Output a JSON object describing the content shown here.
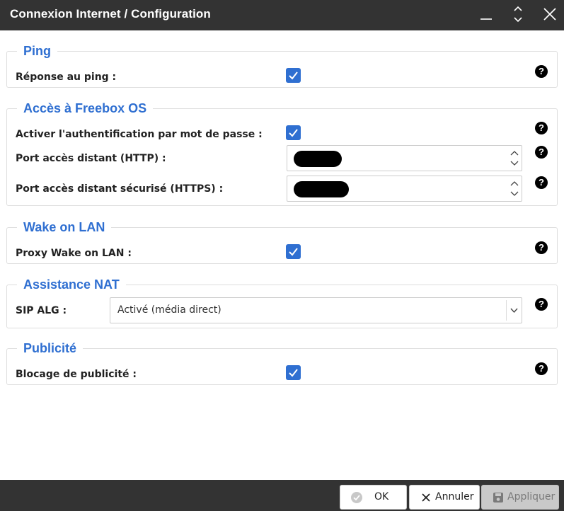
{
  "window": {
    "title": "Connexion Internet / Configuration",
    "controls": {
      "minimize_icon": "minimize-icon",
      "restore_icon": "expand-collapse-icon",
      "close_icon": "close-icon"
    }
  },
  "sections": {
    "ping": {
      "legend": "Ping",
      "reply_label": "Réponse au ping :",
      "reply_checked": true
    },
    "freebox_os": {
      "legend": "Accès à Freebox OS",
      "auth_label": "Activer l'authentification par mot de passe :",
      "auth_checked": true,
      "http_port_label": "Port accès distant (HTTP) :",
      "https_port_label": "Port accès distant sécurisé (HTTPS) :"
    },
    "wake_on_lan": {
      "legend": "Wake on LAN",
      "proxy_label": "Proxy Wake on LAN :",
      "proxy_checked": true
    },
    "nat": {
      "legend": "Assistance NAT",
      "sip_alg_label": "SIP ALG :",
      "sip_alg_value": "Activé (média direct)"
    },
    "ads": {
      "legend": "Publicité",
      "block_label": "Blocage de publicité :",
      "block_checked": true
    }
  },
  "help_glyph": "?",
  "footer": {
    "ok_label": "OK",
    "cancel_label": "Annuler",
    "apply_label": "Appliquer",
    "apply_enabled": false
  },
  "colors": {
    "accent": "#2f6fd1",
    "titlebar": "#333333",
    "border": "#dedede"
  }
}
